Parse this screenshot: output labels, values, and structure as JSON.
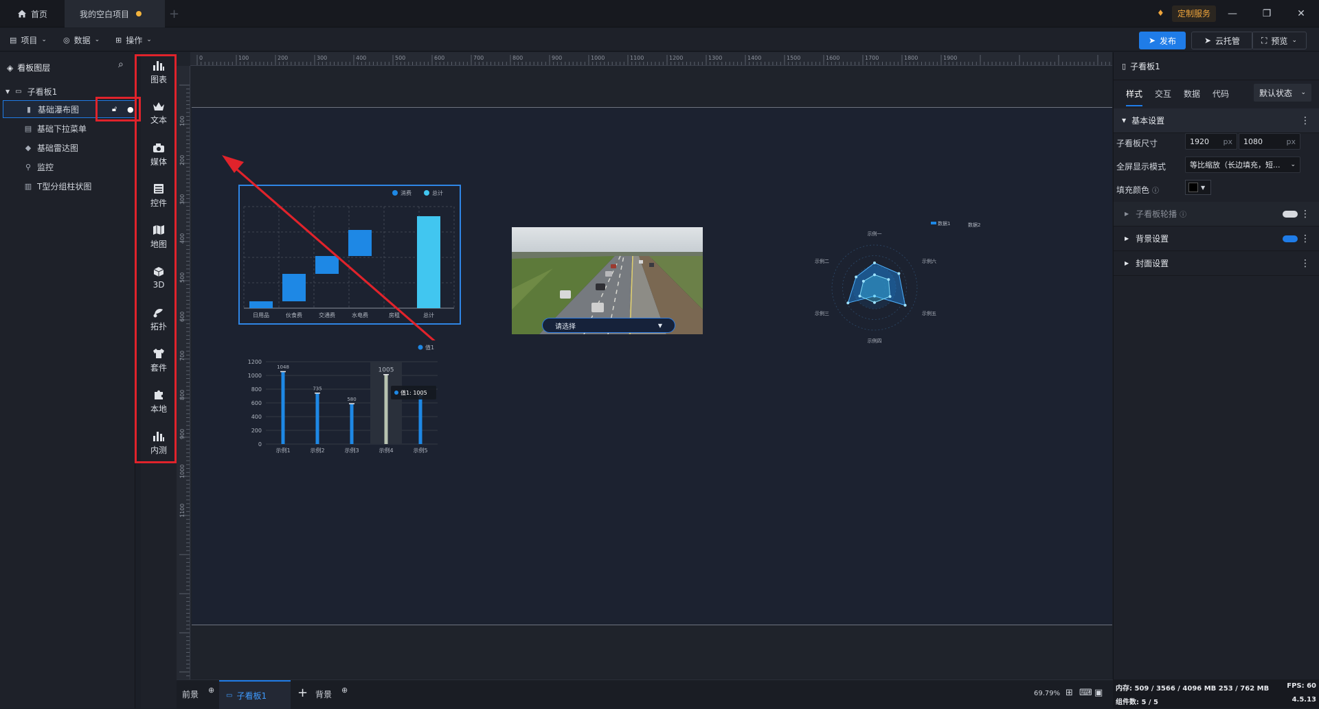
{
  "titlebar": {
    "home_tab": "首页",
    "project_tab": "我的空白项目",
    "custom_service": "定制服务"
  },
  "toolbar": {
    "menus": [
      "项目",
      "数据",
      "操作"
    ],
    "publish": "发布",
    "cloud": "云托管",
    "preview": "预览"
  },
  "layers": {
    "title": "看板图层",
    "group": "子看板1",
    "items": [
      "基础瀑布图",
      "基础下拉菜单",
      "基础雷达图",
      "监控",
      "T型分组柱状图"
    ]
  },
  "rail": {
    "items": [
      "图表",
      "文本",
      "媒体",
      "控件",
      "地图",
      "3D",
      "拓扑",
      "套件",
      "本地",
      "内测"
    ]
  },
  "ruler": {
    "top_ticks": [
      "0",
      "100",
      "200",
      "300",
      "400",
      "500",
      "600",
      "700",
      "800",
      "900",
      "1000",
      "1100",
      "1200",
      "1300",
      "1400",
      "1500",
      "1600",
      "1700",
      "1800",
      "1900"
    ],
    "left_ticks": [
      "100",
      "200",
      "300",
      "400",
      "500",
      "600",
      "700",
      "800",
      "900",
      "1000",
      "1100"
    ]
  },
  "waterfall": {
    "legend": [
      "消费",
      "总计"
    ],
    "categories": [
      "日用品",
      "伙食费",
      "交通费",
      "水电费",
      "房租",
      "总计"
    ]
  },
  "bar_chart": {
    "legend": "值1",
    "categories": [
      "示例1",
      "示例2",
      "示例3",
      "示例4",
      "示例5"
    ],
    "values": [
      1048,
      735,
      580,
      1005,
      700
    ],
    "value_labels": [
      "1048",
      "735",
      "580",
      "1005"
    ],
    "yticks": [
      "1200",
      "1000",
      "800",
      "600",
      "400",
      "200",
      "0"
    ],
    "ylim": [
      0,
      1200
    ],
    "tooltip": "值1:  1005"
  },
  "dropdown": {
    "placeholder": "请选择"
  },
  "radar": {
    "legend": [
      "数据1",
      "数据2"
    ],
    "axes": [
      "示例一",
      "示例六",
      "示例五",
      "示例四",
      "示例三",
      "示例二"
    ],
    "series1": [
      0.58,
      0.66,
      0.83,
      0.2,
      0.72,
      0.5
    ],
    "series2": [
      0.3,
      0.38,
      0.42,
      0.35,
      0.4,
      0.3
    ]
  },
  "props": {
    "panel_title": "子看板1",
    "tabs": [
      "样式",
      "交互",
      "数据",
      "代码"
    ],
    "state": "默认状态",
    "basic_section": "基本设置",
    "size_label": "子看板尺寸",
    "width": "1920",
    "height": "1080",
    "unit": "px",
    "fullscreen_label": "全屏显示模式",
    "fullscreen_value": "等比缩放（长边填充，短...",
    "fill_label": "填充颜色",
    "carousel": "子看板轮播",
    "background": "背景设置",
    "cover": "封面设置"
  },
  "bottom": {
    "foreground": "前景",
    "board_tab": "子看板1",
    "background": "背景",
    "zoom": "69.79%"
  },
  "status": {
    "memory": "内存:  509 / 3566 / 4096 MB  253 / 762 MB",
    "fps": "FPS:  60",
    "components": "组件数: 5 / 5",
    "version": "4.5.13"
  }
}
